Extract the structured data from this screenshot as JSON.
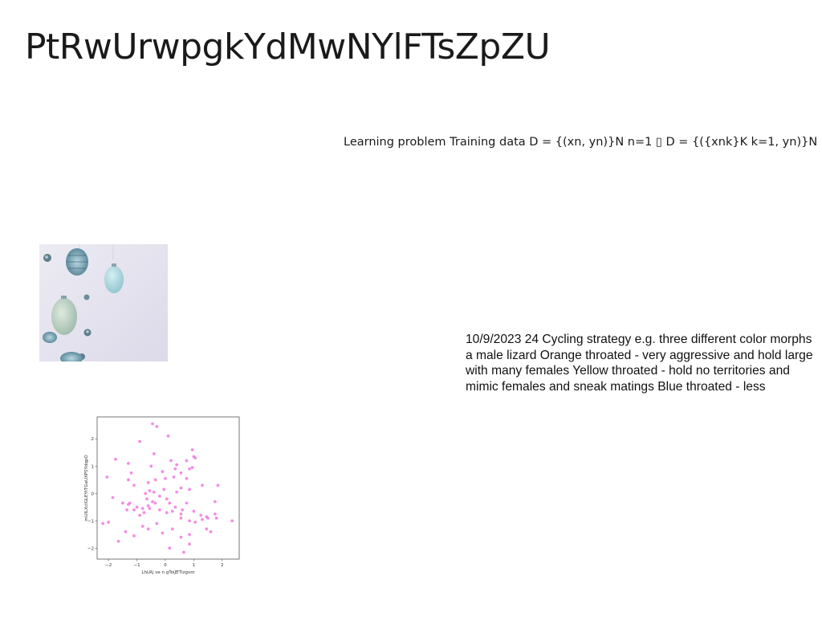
{
  "slide": {
    "title": "PtRwUrwpgkYdMwNYlFTsZpZU",
    "formula_text": "Learning problem Training data D = {(xn, yn)}N n=1 ▯ D = {({xnk}K k=1, yn)}N n=1",
    "body_text": "10/9/2023 24 Cycling strategy e.g. three different color morphs a male lizard Orange throated - very aggressive and hold large with many females Yellow throated - hold no territories and mimic females and sneak matings Blue throated - less"
  },
  "chart_data": {
    "type": "scatter",
    "title": "",
    "xlabel": "LhLRj ve n gToiJETIzgvm",
    "ylabel": "mUlLXcIGLEYtTGaUXPSYdqpO",
    "xlim": [
      -2.4,
      2.6
    ],
    "ylim": [
      -2.4,
      2.8
    ],
    "xticks": [
      -2,
      -1,
      0,
      1,
      2
    ],
    "yticks": [
      -2,
      -1,
      0,
      1,
      2
    ],
    "x_tick_labels": [
      "−2",
      "−1",
      "0",
      "1",
      "2"
    ],
    "y_tick_labels": [
      "−2",
      "−1",
      "0",
      "1",
      "2"
    ],
    "grid": false,
    "marker_color": "#f27ae0",
    "series": [
      {
        "x": [
          -0.45,
          -0.3,
          0.1,
          -0.9,
          0.95,
          1.0,
          0.75,
          -0.4,
          -0.5,
          0.2,
          0.4,
          0.55,
          0.95,
          1.05,
          0.85,
          -1.75,
          -1.3,
          -2.05,
          -1.2,
          -0.35,
          0.0,
          -0.1,
          0.3,
          0.55,
          0.85,
          1.3,
          1.85,
          -1.3,
          -1.1,
          -0.6,
          -0.55,
          0.4,
          -1.85,
          -1.5,
          -1.25,
          -1.0,
          -0.8,
          -0.6,
          -0.45,
          -0.2,
          0.05,
          0.35,
          0.6,
          0.75,
          1.0,
          1.25,
          1.45,
          1.8,
          -2.0,
          -1.35,
          -1.1,
          -0.9,
          -0.75,
          -0.55,
          -0.35,
          -0.2,
          0.05,
          0.25,
          0.55,
          0.85,
          1.05,
          1.5,
          1.75,
          -2.2,
          -1.4,
          -1.1,
          -0.8,
          -0.6,
          -0.3,
          -0.1,
          0.25,
          0.55,
          0.85,
          1.45,
          1.6,
          1.75,
          2.35,
          -0.7,
          -0.4,
          -0.05,
          0.35,
          0.75,
          1.3,
          -0.65,
          0.15,
          0.85,
          0.55,
          0.15,
          0.65,
          -1.3,
          -1.65
        ],
        "y": [
          2.55,
          2.45,
          2.1,
          1.9,
          1.6,
          1.35,
          1.2,
          1.45,
          1.0,
          1.2,
          1.05,
          0.75,
          0.95,
          1.3,
          0.9,
          1.25,
          1.1,
          0.6,
          0.75,
          0.5,
          0.55,
          0.8,
          0.6,
          0.2,
          0.15,
          0.3,
          0.3,
          0.5,
          0.3,
          0.4,
          0.1,
          0.05,
          -0.15,
          -0.35,
          -0.35,
          -0.5,
          -0.55,
          -0.45,
          -0.3,
          -0.1,
          -0.2,
          -0.5,
          -0.6,
          -0.35,
          -0.65,
          -0.8,
          -0.85,
          -0.9,
          -1.05,
          -0.6,
          -0.6,
          -0.8,
          -0.7,
          -0.55,
          -0.35,
          -0.6,
          -0.7,
          -0.65,
          -0.9,
          -1.0,
          -1.05,
          -0.9,
          -0.75,
          -1.1,
          -1.4,
          -1.55,
          -1.2,
          -1.3,
          -1.1,
          -1.45,
          -1.3,
          -0.75,
          -1.5,
          -1.3,
          -1.4,
          -0.3,
          -1.0,
          0.0,
          0.05,
          0.15,
          0.9,
          0.55,
          -0.95,
          -0.2,
          -0.35,
          -1.85,
          -1.6,
          -2.0,
          -2.15,
          -0.4,
          -1.75
        ]
      }
    ]
  }
}
